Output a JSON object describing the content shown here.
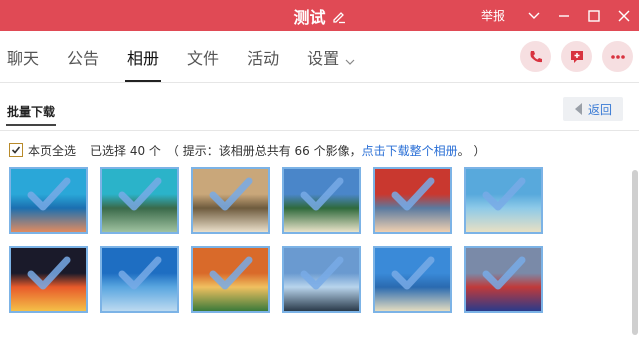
{
  "window": {
    "title": "测试",
    "report_label": "举报"
  },
  "tabs": [
    {
      "label": "聊天"
    },
    {
      "label": "公告"
    },
    {
      "label": "相册"
    },
    {
      "label": "文件"
    },
    {
      "label": "活动"
    },
    {
      "label": "设置"
    }
  ],
  "active_tab": "相册",
  "subheader": {
    "title": "批量下载",
    "back_label": "返回"
  },
  "selection": {
    "select_all_label": "本页全选",
    "selected_text": "已选择 40 个",
    "hint_prefix": "（ 提示：该相册总共有 66 个影像，",
    "hint_link": "点击下载整个相册",
    "hint_suffix": "。 ）",
    "checked": true
  },
  "photos": [
    {
      "name": "snorkel-hand",
      "colors": [
        "#2aa7d8",
        "#1b6fb0",
        "#e08b60"
      ],
      "selected": true
    },
    {
      "name": "lagoon-cliffs",
      "colors": [
        "#2bb3c9",
        "#3a6a4a",
        "#9fc2a0"
      ],
      "selected": true
    },
    {
      "name": "seafood-plate",
      "colors": [
        "#c9a77a",
        "#6e5b3e",
        "#eadfca"
      ],
      "selected": true
    },
    {
      "name": "island-beach",
      "colors": [
        "#4a86c9",
        "#2f6a3c",
        "#e9e2c9"
      ],
      "selected": true
    },
    {
      "name": "child-portrait",
      "colors": [
        "#c9382f",
        "#5a7aa0",
        "#f0d0b0"
      ],
      "selected": true
    },
    {
      "name": "shore-sky",
      "colors": [
        "#58a9dc",
        "#8ecae8",
        "#e8e0c4"
      ],
      "selected": true
    },
    {
      "name": "night-market",
      "colors": [
        "#1a1a2a",
        "#e85a2a",
        "#f4c048"
      ],
      "selected": true
    },
    {
      "name": "blue-sea",
      "colors": [
        "#1e6ec2",
        "#5aa6e0",
        "#bcdaf0"
      ],
      "selected": true
    },
    {
      "name": "thai-dishes",
      "colors": [
        "#d96a2a",
        "#f0c060",
        "#3a7a3a"
      ],
      "selected": true
    },
    {
      "name": "palm-horizon",
      "colors": [
        "#6a9ad0",
        "#b8d4ec",
        "#2a3a4a"
      ],
      "selected": true
    },
    {
      "name": "boat-beach",
      "colors": [
        "#3a8ad8",
        "#2a6ab0",
        "#e4dcc0"
      ],
      "selected": true
    },
    {
      "name": "girl-arch",
      "colors": [
        "#7a8aa8",
        "#c03a3a",
        "#2a3a8a"
      ],
      "selected": true
    }
  ]
}
